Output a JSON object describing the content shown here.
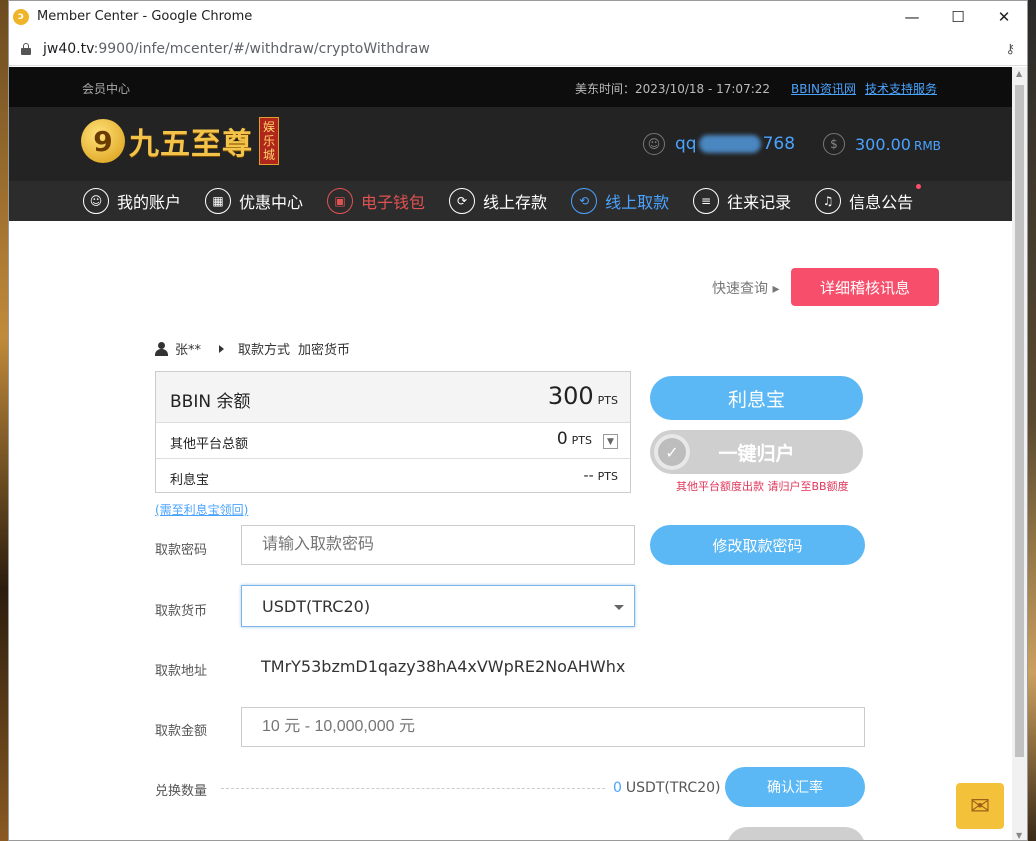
{
  "window": {
    "title": "Member Center - Google Chrome",
    "minimize": "—",
    "maximize": "☐",
    "close": "✕"
  },
  "address": {
    "host": "jw40.tv",
    "path": ":9900/infe/mcenter/#/withdraw/cryptoWithdraw"
  },
  "topbar": {
    "member_center": "会员中心",
    "time": "美东时间：2023/10/18 - 17:07:22",
    "news_link": "BBIN资讯网",
    "support_link": "技术支持服务"
  },
  "header": {
    "logo_mark": "9",
    "logo_text": "九五至尊",
    "logo_tag": "娱乐城",
    "username_prefix": "qq",
    "username_suffix": "768",
    "balance": "300.00",
    "balance_unit": "RMB"
  },
  "nav": {
    "items": [
      {
        "label": "我的账户"
      },
      {
        "label": "优惠中心"
      },
      {
        "label": "电子钱包"
      },
      {
        "label": "线上存款"
      },
      {
        "label": "线上取款"
      },
      {
        "label": "往来记录"
      },
      {
        "label": "信息公告"
      }
    ]
  },
  "main": {
    "quick_query": "快速查询",
    "detail_button": "详细稽核讯息",
    "user_name": "张**",
    "withdraw_method_label": "取款方式",
    "withdraw_method_value": "加密货币",
    "bbin_label": "BBIN 余额",
    "bbin_value": "300",
    "other_label": "其他平台总额",
    "other_value": "0",
    "lxb_label": "利息宝",
    "lxb_value": "--",
    "pts": "PTS",
    "lxb_link": "(需至利息宝领回)",
    "lxb_button": "利息宝",
    "onekey_button": "一键归户",
    "onekey_note": "其他平台额度出款 请归户至BB额度",
    "password_label": "取款密码",
    "password_placeholder": "请输入取款密码",
    "change_password_button": "修改取款密码",
    "currency_label": "取款货币",
    "currency_value": "USDT(TRC20)",
    "address_label": "取款地址",
    "address_value": "TMrY53bzmD1qazy38hA4xVWpRE2NoAHWhx",
    "amount_label": "取款金额",
    "amount_placeholder": "10 元 - 10,000,000 元",
    "exchange_label": "兑换数量",
    "exchange_value": "0",
    "exchange_unit": "USDT(TRC20)",
    "rate_button": "确认汇率"
  }
}
